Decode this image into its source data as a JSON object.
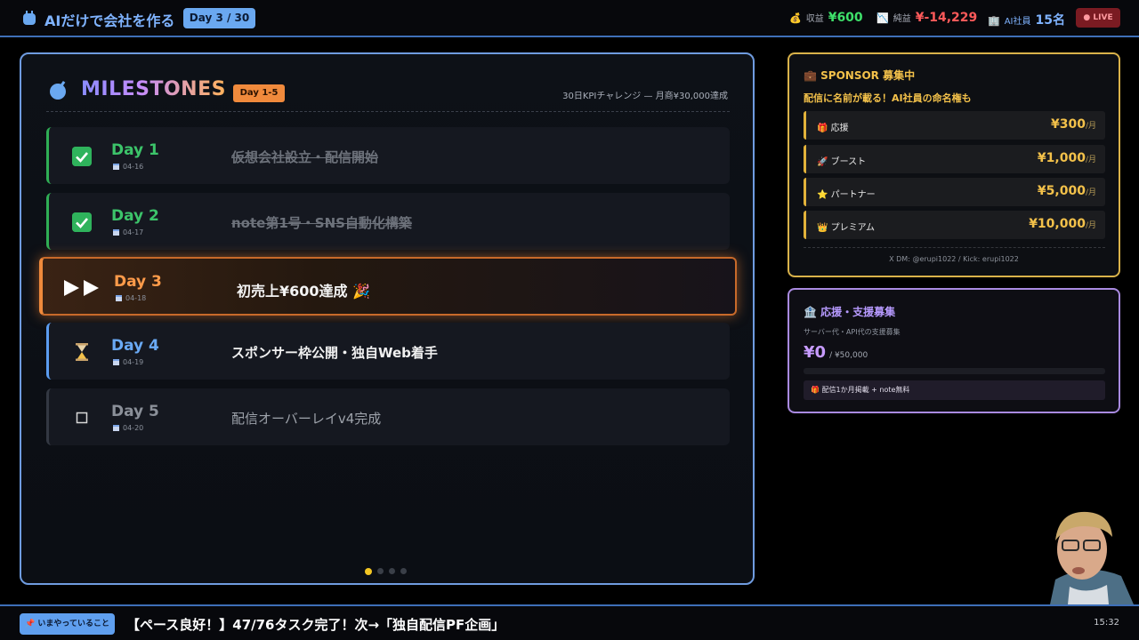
{
  "header": {
    "title": "AIだけで会社を作る",
    "day_badge": "Day 3 / 30",
    "stats": [
      {
        "icon": "money-bag-icon",
        "label": "収益",
        "value": "¥600",
        "color": "#3ee06a"
      },
      {
        "icon": "chart-down-icon",
        "label": "純益",
        "value": "¥-14,229",
        "color": "#ff5a5a"
      },
      {
        "icon": "building-icon",
        "label": "AI社員",
        "value": "15名",
        "color": "#7fb3ff"
      }
    ],
    "live": "● LIVE"
  },
  "milestones": {
    "title": "MILESTONES",
    "range": "Day 1-5",
    "kpi": "30日KPIチャレンジ — 月商¥30,000達成",
    "items": [
      {
        "day": "Day 1",
        "date": "04-16",
        "task": "仮想会社設立・配信開始",
        "status": "done"
      },
      {
        "day": "Day 2",
        "date": "04-17",
        "task": "note第1号・SNS自動化構築",
        "status": "done"
      },
      {
        "day": "Day 3",
        "date": "04-18",
        "task": "初売上¥600達成 🎉",
        "status": "current"
      },
      {
        "day": "Day 4",
        "date": "04-19",
        "task": "スポンサー枠公開・独自Web着手",
        "status": "next"
      },
      {
        "day": "Day 5",
        "date": "04-20",
        "task": "配信オーバーレイv4完成",
        "status": "todo"
      }
    ],
    "pager": {
      "pages": 4,
      "active": 1
    }
  },
  "sponsor": {
    "title": "SPONSOR 募集中",
    "subtitle": "配信に名前が載る！AI社員の命名権も",
    "tiers": [
      {
        "icon": "gift-icon",
        "name": "応援",
        "price": "¥300",
        "unit": "/月"
      },
      {
        "icon": "rocket-icon",
        "name": "ブースト",
        "price": "¥1,000",
        "unit": "/月"
      },
      {
        "icon": "star-icon",
        "name": "パートナー",
        "price": "¥5,000",
        "unit": "/月"
      },
      {
        "icon": "crown-icon",
        "name": "プレミアム",
        "price": "¥10,000",
        "unit": "/月"
      }
    ],
    "contact": "X DM: @erupi1022 / Kick: erupi1022"
  },
  "support": {
    "title": "応援・支援募集",
    "description": "サーバー代・API代の支援募集",
    "current": "¥0",
    "goal": "/ ¥50,000",
    "progress": 0,
    "perk": "配信1か月掲載 + note無料"
  },
  "footer": {
    "now_label": "いまやっていること",
    "ticker": "【ペース良好！】47/76タスク完了！次→「独自配信PF企画」",
    "clock": "15:32"
  },
  "colors": {
    "accent_blue": "#6aa8f0",
    "current_orange": "#f08a3c",
    "done_green": "#3cc46a",
    "sponsor_gold": "#f3c14a",
    "support_purple": "#b79aff"
  }
}
